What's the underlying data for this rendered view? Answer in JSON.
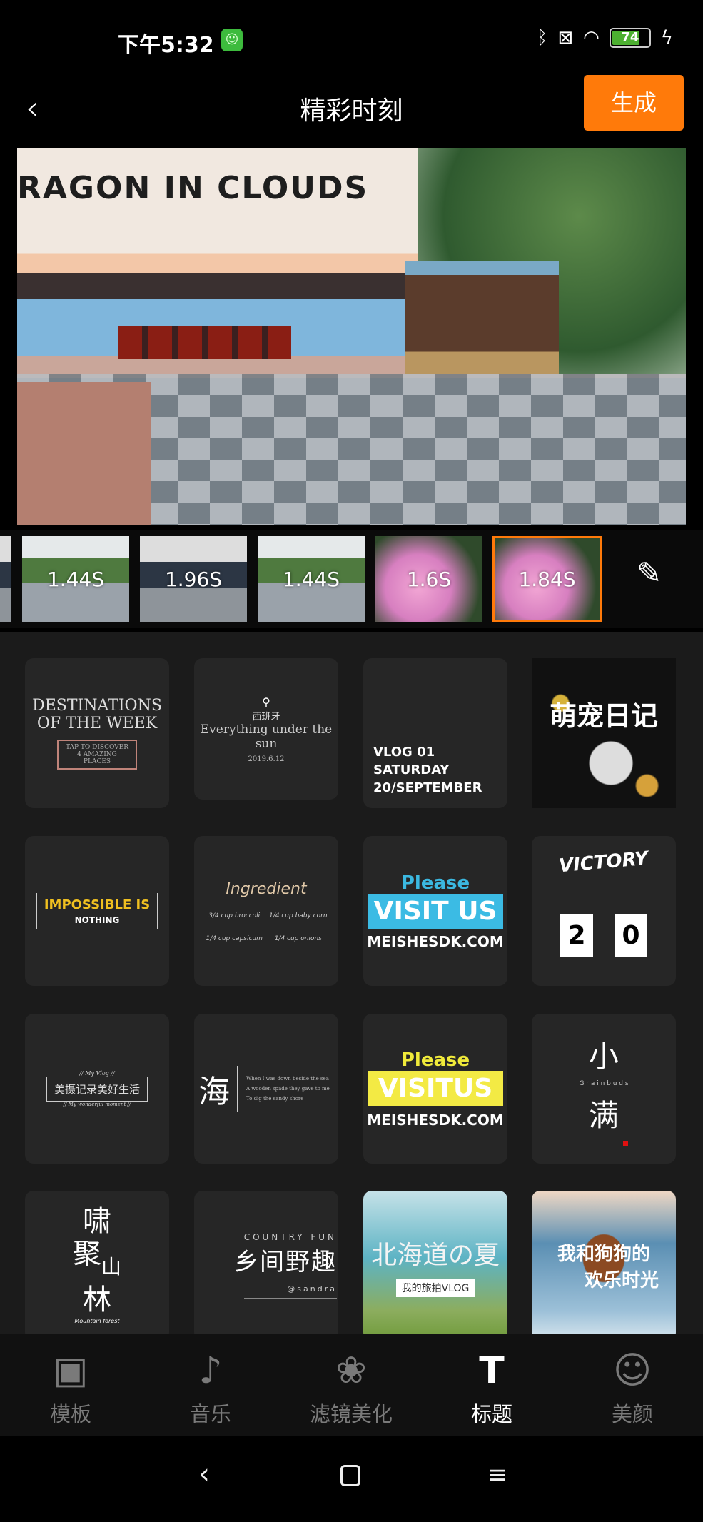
{
  "status_bar": {
    "time": "下午5:32",
    "battery": "74",
    "battery_level": 0.74,
    "icons": [
      "bluetooth-icon",
      "sim-off-icon",
      "wifi-icon",
      "battery-icon",
      "charging-icon"
    ]
  },
  "header": {
    "title": "精彩时刻",
    "generate_label": "生成",
    "back_icon": "chevron-left-icon"
  },
  "preview": {
    "sign_text": "RAGON IN CLOUDS"
  },
  "clips": [
    {
      "duration": ""
    },
    {
      "duration": "1.44S"
    },
    {
      "duration": "1.96S"
    },
    {
      "duration": "1.44S"
    },
    {
      "duration": "1.6S"
    },
    {
      "duration": "1.84S",
      "selected": true
    }
  ],
  "templates": {
    "t1": {
      "line1": "DESTINATIONS",
      "line2": "OF THE WEEK",
      "box": "TAP TO DISCOVER 4 AMAZING PLACES"
    },
    "t2": {
      "place": "西班牙",
      "line": "Everything under the sun",
      "date": "2019.6.12"
    },
    "t3": {
      "line1": "VLOG 01",
      "line2": "SATURDAY",
      "line3": "20/SEPTEMBER"
    },
    "t4": {
      "title": "萌宠日记"
    },
    "t5": {
      "line1": "IMPOSSIBLE IS",
      "line2": "NOTHING"
    },
    "t6": {
      "title": "Ingredient",
      "items": [
        "3/4 cup broccoli",
        "1/4 cup baby corn",
        "1/4 cup capsicum",
        "1/4 cup onions"
      ]
    },
    "t7": {
      "line1": "Please",
      "line2": "VISIT US",
      "line3": "MEISHESDK.COM"
    },
    "t8": {
      "title": "VICTORY",
      "d1": "2",
      "d2": "0"
    },
    "t9": {
      "top": "// My Vlog //",
      "main": "美摄记录美好生活",
      "bottom": "// My wonderful moment //"
    },
    "t10": {
      "char": "海",
      "l1": "When I was down beside the sea",
      "l2": "A wooden spade they gave to me",
      "l3": "To dig the sandy shore"
    },
    "t11": {
      "line1": "Please",
      "line2": "VISITUS",
      "line3": "MEISHESDK.COM"
    },
    "t12": {
      "c1": "小",
      "sub": "G r a i n b u d s",
      "c2": "满"
    },
    "t13": {
      "c1": "啸",
      "c2": "聚",
      "c3": "山",
      "c4": "林",
      "sub": "Mountain forest"
    },
    "t14": {
      "top": "COUNTRY FUN",
      "main": "乡间野趣",
      "handle": "@sandra"
    },
    "t15": {
      "main": "北海道の夏",
      "sub": "我的旅拍VLOG"
    },
    "t16": {
      "l1": "我和狗狗的",
      "l2": "欢乐时光"
    }
  },
  "tabs": [
    {
      "label": "模板",
      "icon": "template-icon"
    },
    {
      "label": "音乐",
      "icon": "music-icon"
    },
    {
      "label": "滤镜美化",
      "icon": "filter-icon"
    },
    {
      "label": "标题",
      "icon": "title-icon",
      "active": true
    },
    {
      "label": "美颜",
      "icon": "beauty-icon"
    }
  ],
  "colors": {
    "accent": "#ff7a0a",
    "background": "#1b1b1b",
    "card": "#262626"
  }
}
